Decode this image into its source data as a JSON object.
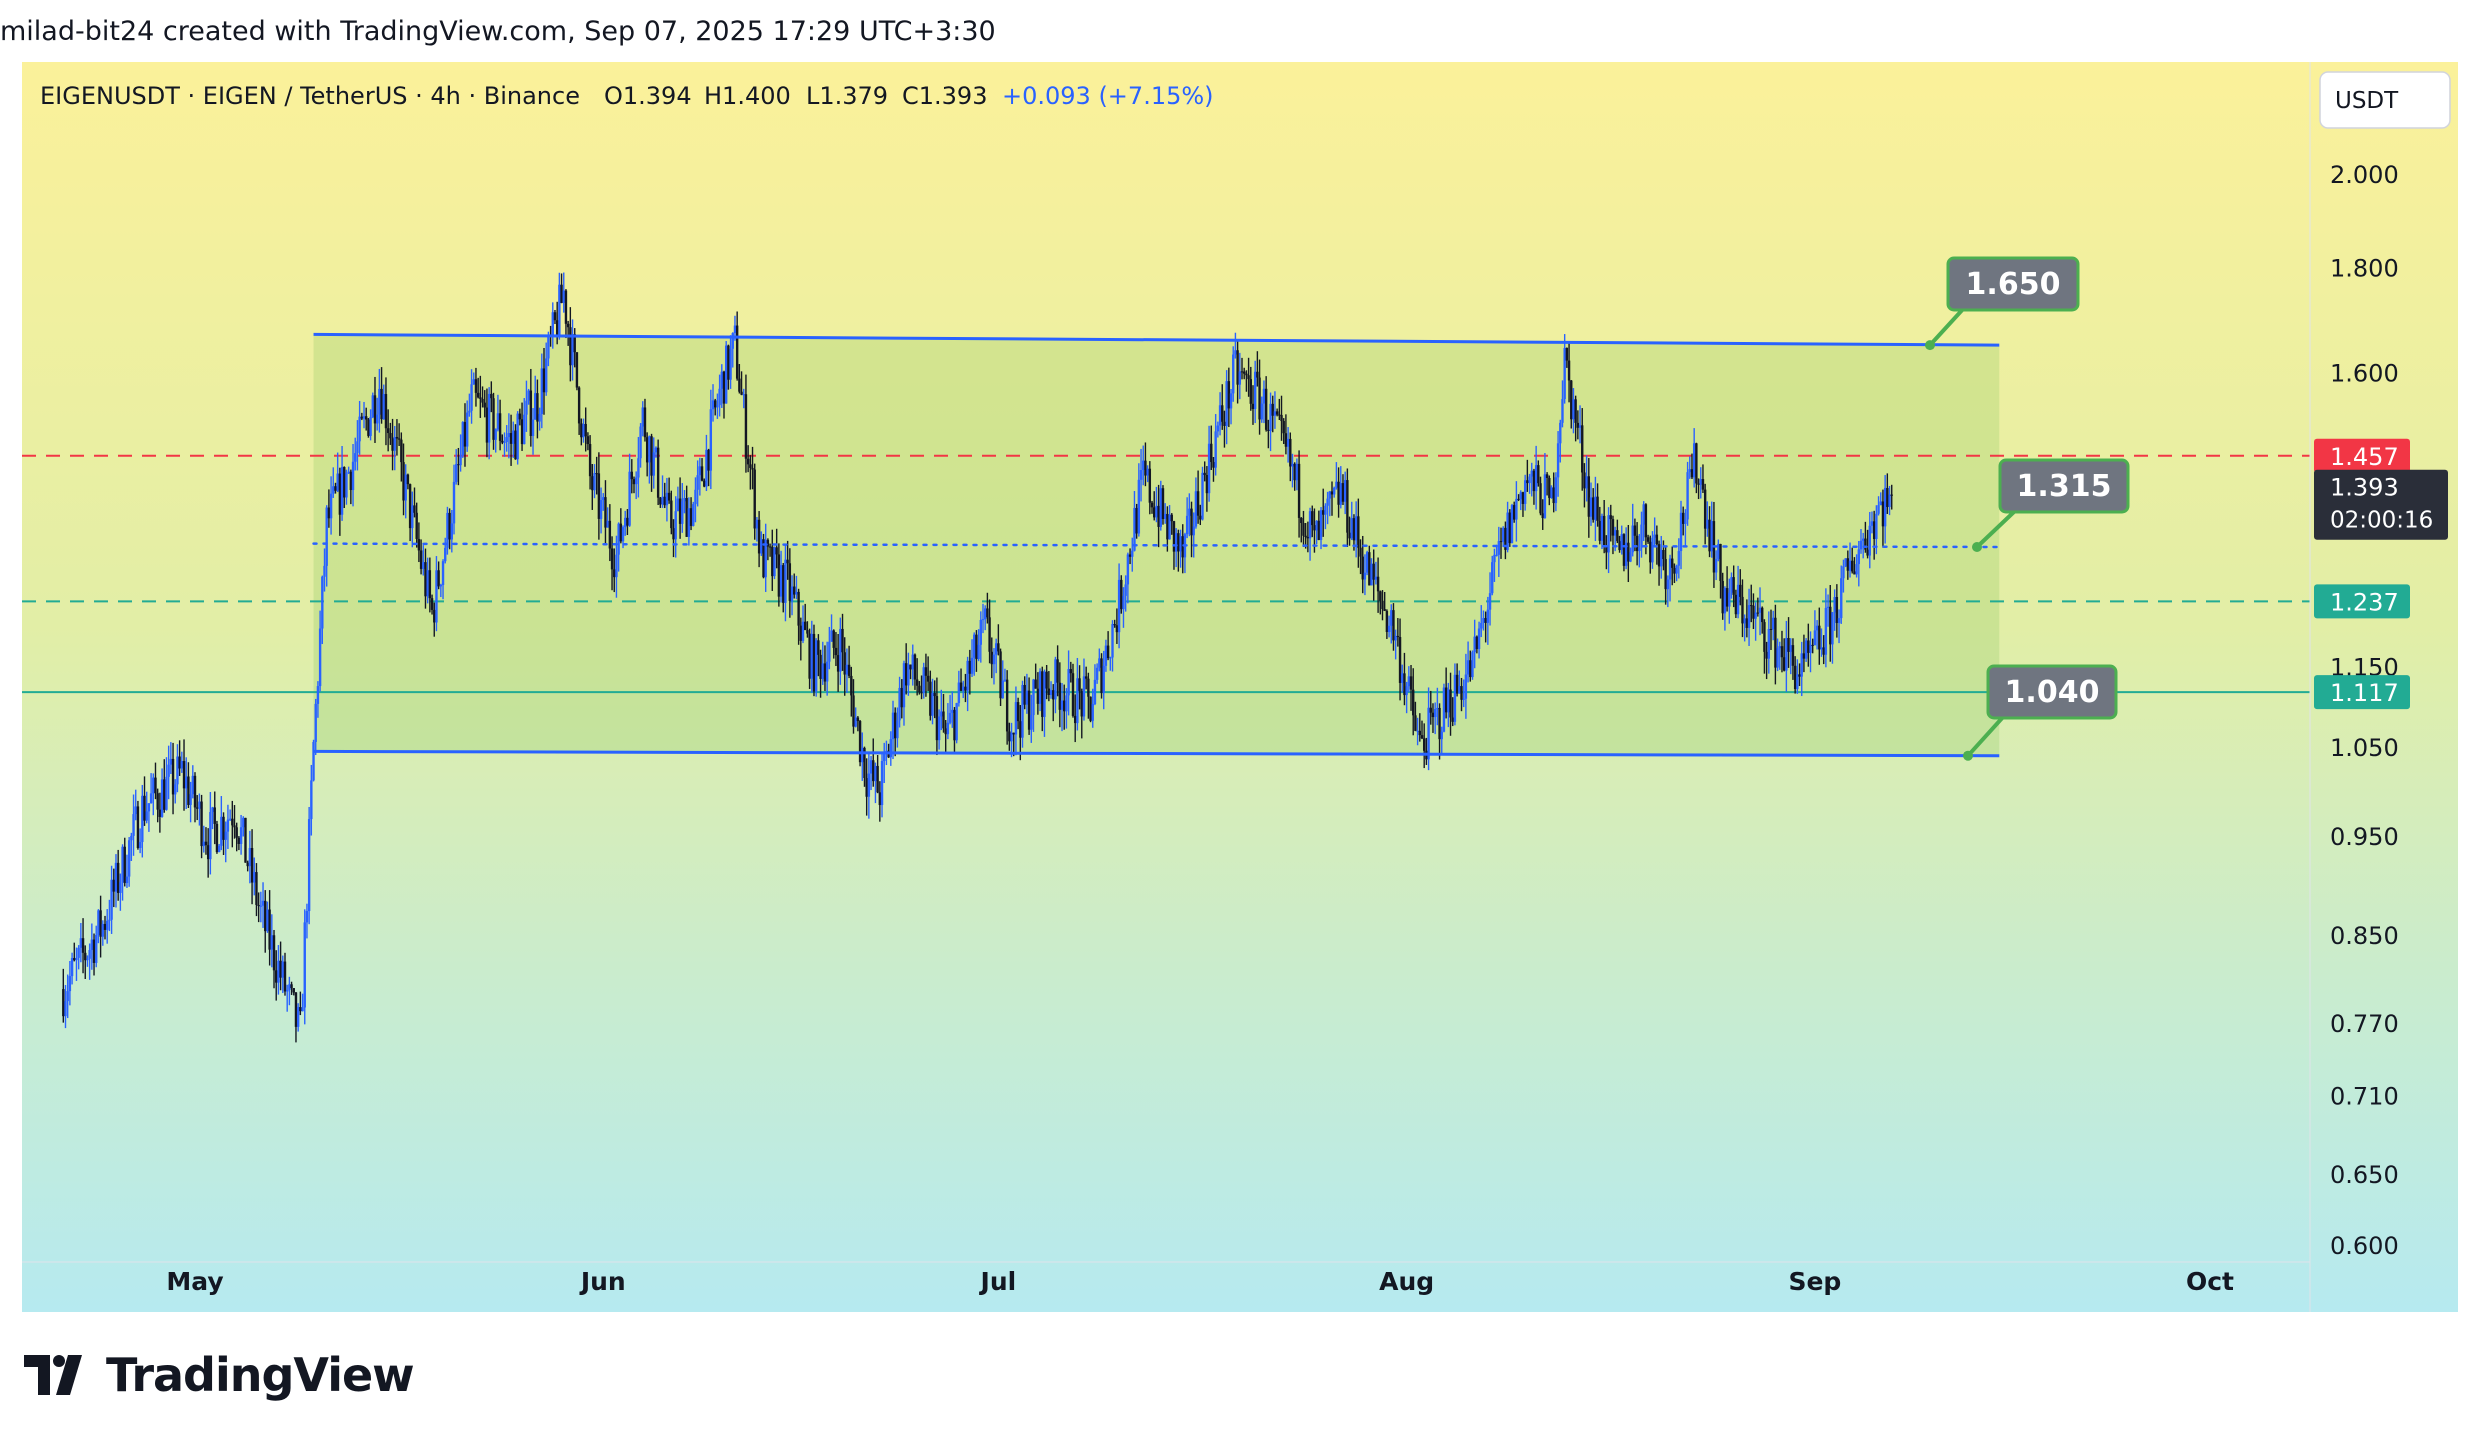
{
  "credit": "milad-bit24 created with TradingView.com, Sep 07, 2025 17:29 UTC+3:30",
  "brand": "TradingView",
  "legend": {
    "symbol": "EIGENUSDT · EIGEN / TetherUS · 4h · Binance",
    "open": "O1.394",
    "high": "H1.400",
    "low": "L1.379",
    "close": "C1.393",
    "change": "+0.093 (+7.15%)"
  },
  "currency": "USDT",
  "colors": {
    "candle_up": "#2962ff",
    "candle_down": "#131722",
    "channel_line": "#2962ff",
    "resistance": "#f23645",
    "support": "#22ab94",
    "label_box": "#6f7580",
    "label_border": "#4caf50"
  },
  "chart_data": {
    "type": "candlestick",
    "title": "EIGENUSDT · EIGEN / TetherUS · 4h · Binance",
    "y_scale": "log",
    "ylim": [
      0.6,
      2.2
    ],
    "x_range": [
      "2025-04-21",
      "2025-10-07"
    ],
    "x_ticks": [
      {
        "label": "May",
        "date": "2025-05-01"
      },
      {
        "label": "Jun",
        "date": "2025-06-01"
      },
      {
        "label": "Jul",
        "date": "2025-07-01"
      },
      {
        "label": "Aug",
        "date": "2025-08-01"
      },
      {
        "label": "Sep",
        "date": "2025-09-01"
      },
      {
        "label": "Oct",
        "date": "2025-10-01"
      }
    ],
    "y_ticks": [
      "2.000",
      "1.800",
      "1.600",
      "1.150",
      "1.050",
      "0.950",
      "0.850",
      "0.770",
      "0.710",
      "0.650",
      "0.600"
    ],
    "price_path": [
      [
        "2025-04-21",
        0.8
      ],
      [
        "2025-04-24",
        0.86
      ],
      [
        "2025-04-27",
        0.98
      ],
      [
        "2025-04-30",
        1.02
      ],
      [
        "2025-05-02",
        0.95
      ],
      [
        "2025-05-04",
        0.98
      ],
      [
        "2025-05-06",
        0.87
      ],
      [
        "2025-05-09",
        0.76
      ],
      [
        "2025-05-10",
        1.05
      ],
      [
        "2025-05-11",
        1.35
      ],
      [
        "2025-05-13",
        1.45
      ],
      [
        "2025-05-15",
        1.58
      ],
      [
        "2025-05-17",
        1.4
      ],
      [
        "2025-05-19",
        1.22
      ],
      [
        "2025-05-22",
        1.55
      ],
      [
        "2025-05-25",
        1.48
      ],
      [
        "2025-05-27",
        1.55
      ],
      [
        "2025-05-29",
        1.75
      ],
      [
        "2025-05-31",
        1.42
      ],
      [
        "2025-06-02",
        1.3
      ],
      [
        "2025-06-04",
        1.52
      ],
      [
        "2025-06-06",
        1.35
      ],
      [
        "2025-06-08",
        1.38
      ],
      [
        "2025-06-10",
        1.58
      ],
      [
        "2025-06-11",
        1.65
      ],
      [
        "2025-06-13",
        1.3
      ],
      [
        "2025-06-15",
        1.26
      ],
      [
        "2025-06-17",
        1.15
      ],
      [
        "2025-06-19",
        1.18
      ],
      [
        "2025-06-21",
        1.02
      ],
      [
        "2025-06-22",
        1.0
      ],
      [
        "2025-06-24",
        1.15
      ],
      [
        "2025-06-26",
        1.1
      ],
      [
        "2025-06-27",
        1.06
      ],
      [
        "2025-06-30",
        1.2
      ],
      [
        "2025-07-02",
        1.08
      ],
      [
        "2025-07-05",
        1.13
      ],
      [
        "2025-07-08",
        1.1
      ],
      [
        "2025-07-10",
        1.22
      ],
      [
        "2025-07-12",
        1.42
      ],
      [
        "2025-07-15",
        1.3
      ],
      [
        "2025-07-17",
        1.45
      ],
      [
        "2025-07-19",
        1.6
      ],
      [
        "2025-07-21",
        1.55
      ],
      [
        "2025-07-23",
        1.45
      ],
      [
        "2025-07-25",
        1.32
      ],
      [
        "2025-07-27",
        1.4
      ],
      [
        "2025-07-29",
        1.28
      ],
      [
        "2025-07-31",
        1.2
      ],
      [
        "2025-08-02",
        1.05
      ],
      [
        "2025-08-04",
        1.1
      ],
      [
        "2025-08-06",
        1.15
      ],
      [
        "2025-08-08",
        1.3
      ],
      [
        "2025-08-10",
        1.42
      ],
      [
        "2025-08-12",
        1.38
      ],
      [
        "2025-08-13",
        1.62
      ],
      [
        "2025-08-15",
        1.38
      ],
      [
        "2025-08-17",
        1.3
      ],
      [
        "2025-08-19",
        1.35
      ],
      [
        "2025-08-21",
        1.28
      ],
      [
        "2025-08-23",
        1.45
      ],
      [
        "2025-08-25",
        1.25
      ],
      [
        "2025-08-27",
        1.22
      ],
      [
        "2025-08-29",
        1.18
      ],
      [
        "2025-08-31",
        1.14
      ],
      [
        "2025-09-02",
        1.2
      ],
      [
        "2025-09-04",
        1.3
      ],
      [
        "2025-09-06",
        1.38
      ],
      [
        "2025-09-07",
        1.393
      ]
    ],
    "channel": {
      "upper": [
        [
          "2025-05-10",
          1.67
        ],
        [
          "2025-09-15",
          1.65
        ]
      ],
      "lower": [
        [
          "2025-05-10",
          1.045
        ],
        [
          "2025-09-15",
          1.04
        ]
      ],
      "middle": [
        [
          "2025-05-10",
          1.32
        ],
        [
          "2025-09-15",
          1.315
        ]
      ]
    },
    "levels": [
      {
        "value": 1.457,
        "label": "1.457",
        "style": "dashed",
        "color": "#f23645"
      },
      {
        "value": 1.237,
        "label": "1.237",
        "style": "dashed",
        "color": "#22ab94"
      },
      {
        "value": 1.117,
        "label": "1.117",
        "style": "solid",
        "color": "#22ab94"
      }
    ],
    "annotations": [
      "1.650",
      "1.315",
      "1.040"
    ],
    "last_price": "1.393",
    "countdown": "02:00:16"
  }
}
